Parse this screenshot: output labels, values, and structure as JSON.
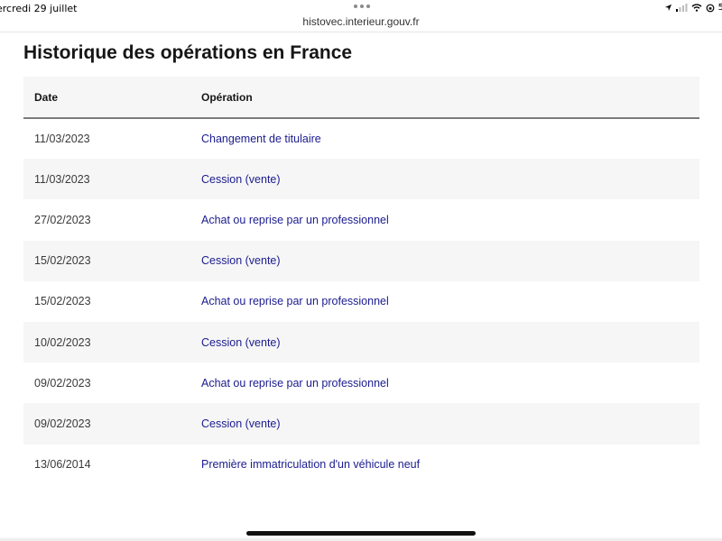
{
  "status_bar": {
    "date": "ercredi 29 juillet",
    "battery_text": "5"
  },
  "browser": {
    "url": "histovec.interieur.gouv.fr"
  },
  "page": {
    "title": "Historique des opérations en France"
  },
  "table": {
    "headers": [
      "Date",
      "Opération"
    ],
    "rows": [
      {
        "date": "11/03/2023",
        "operation": "Changement de titulaire"
      },
      {
        "date": "11/03/2023",
        "operation": "Cession (vente)"
      },
      {
        "date": "27/02/2023",
        "operation": "Achat ou reprise par un professionnel"
      },
      {
        "date": "15/02/2023",
        "operation": "Cession (vente)"
      },
      {
        "date": "15/02/2023",
        "operation": "Achat ou reprise par un professionnel"
      },
      {
        "date": "10/02/2023",
        "operation": "Cession (vente)"
      },
      {
        "date": "09/02/2023",
        "operation": "Achat ou reprise par un professionnel"
      },
      {
        "date": "09/02/2023",
        "operation": "Cession (vente)"
      },
      {
        "date": "13/06/2014",
        "operation": "Première immatriculation d'un véhicule neuf"
      }
    ]
  },
  "colors": {
    "link": "#1b1b8f",
    "stripe": "#f6f6f6",
    "header_border": "#7b7b7b"
  },
  "icons": [
    "location-arrow-icon",
    "cellular-signal-icon",
    "wifi-icon",
    "orientation-lock-icon"
  ]
}
